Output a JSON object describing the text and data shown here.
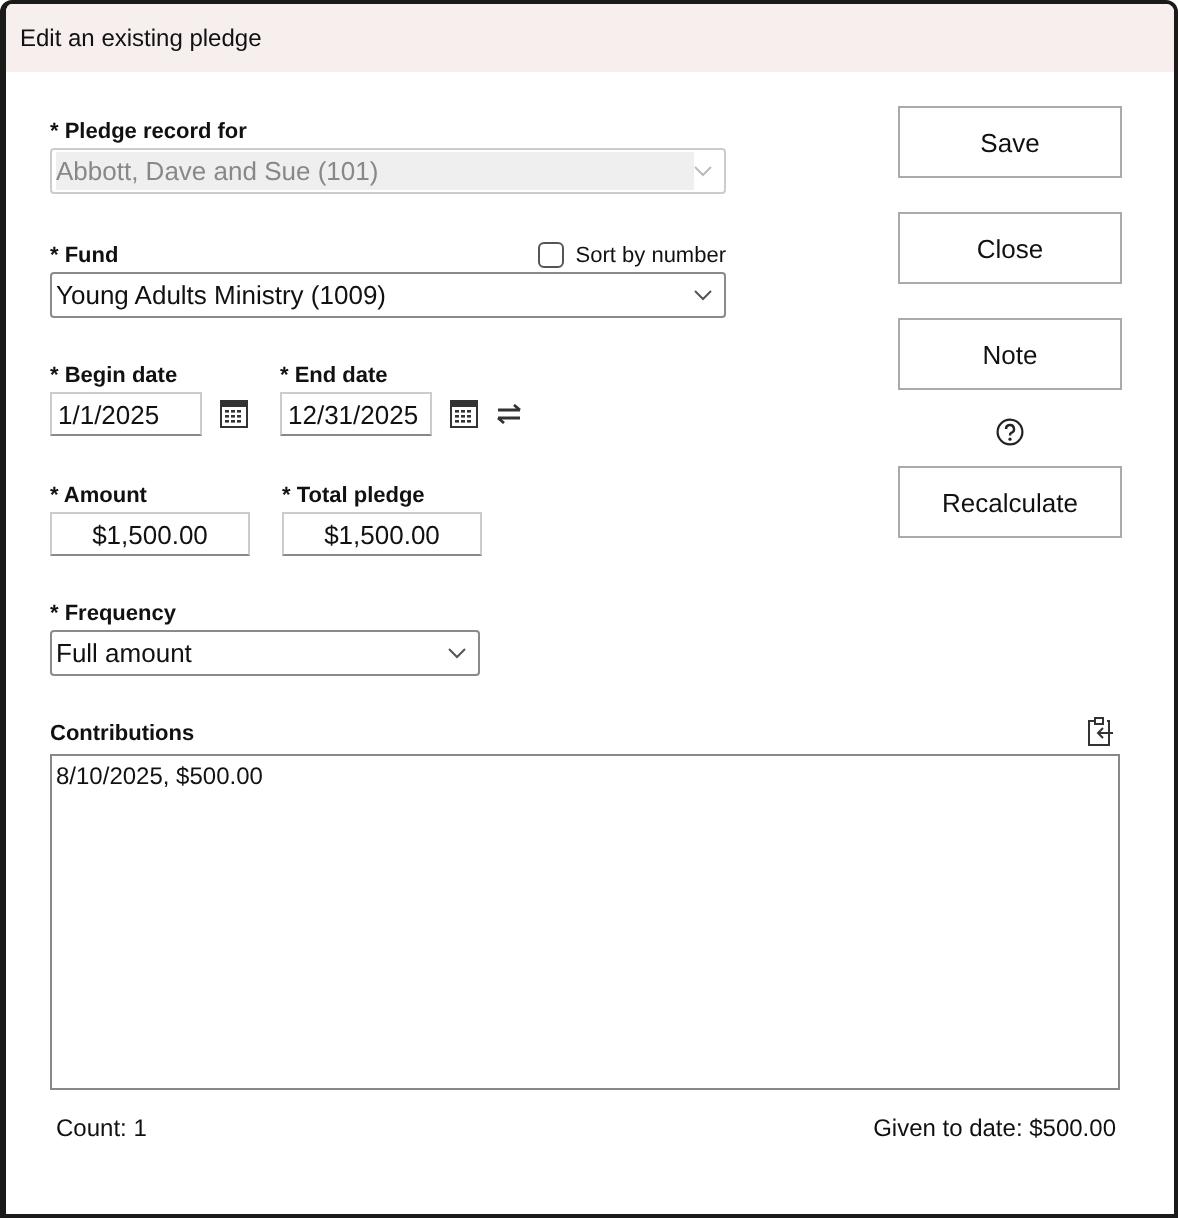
{
  "window": {
    "title": "Edit an existing pledge"
  },
  "pledge_record": {
    "label": "* Pledge record for",
    "value": "Abbott, Dave and Sue (101)",
    "disabled": true
  },
  "fund": {
    "label": "* Fund",
    "value": "Young Adults Ministry (1009)",
    "disabled": false,
    "sort_by_number": {
      "label": "Sort by number",
      "checked": false
    }
  },
  "begin_date": {
    "label": "* Begin date",
    "value": "1/1/2025"
  },
  "end_date": {
    "label": "* End date",
    "value": "12/31/2025"
  },
  "amount": {
    "label": "* Amount",
    "value": "$1,500.00"
  },
  "total_pledge": {
    "label": "* Total pledge",
    "value": "$1,500.00"
  },
  "frequency": {
    "label": "* Frequency",
    "value": "Full amount"
  },
  "buttons": [
    {
      "label": "Save",
      "kind": "button"
    },
    {
      "label": "Close",
      "kind": "button"
    },
    {
      "label": "Note",
      "kind": "button"
    },
    {
      "kind": "help"
    },
    {
      "label": "Recalculate",
      "kind": "button"
    }
  ],
  "contributions": {
    "label": "Contributions",
    "items": [
      "8/10/2025, $500.00"
    ]
  },
  "footer": {
    "count": "Count: 1",
    "given_to_date": "Given to date: $500.00"
  }
}
